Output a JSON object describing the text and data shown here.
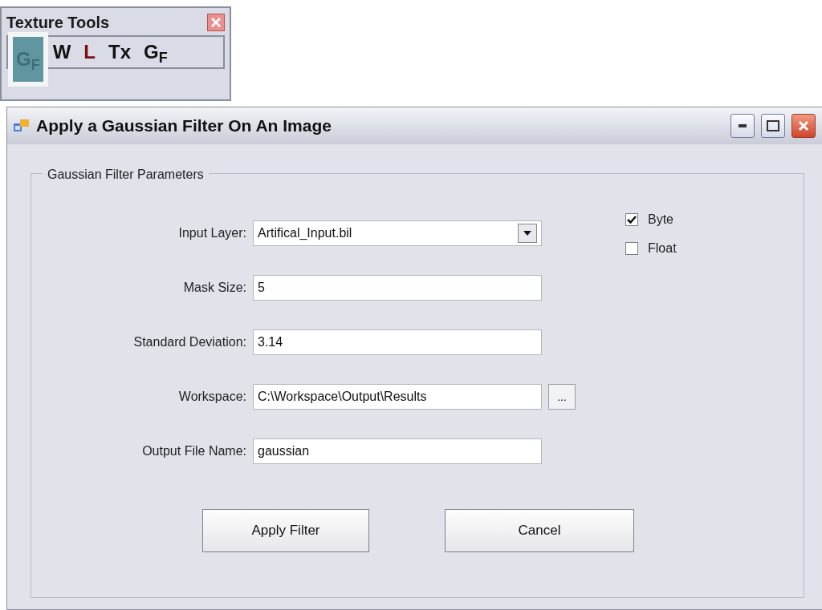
{
  "toolbar": {
    "title": "Texture Tools",
    "tools": [
      {
        "label": "G$_{F}$",
        "selected": true,
        "color": "#3f6e78"
      },
      {
        "label": "W",
        "selected": false,
        "color": "#111111"
      },
      {
        "label": "L",
        "selected": false,
        "color": "#7a0d0d"
      },
      {
        "label": "Tx",
        "selected": false,
        "color": "#111111"
      },
      {
        "label": "G$_{F}$",
        "selected": false,
        "color": "#111111"
      }
    ]
  },
  "dialog": {
    "title": "Apply a Gaussian Filter On An Image",
    "group_title": "Gaussian Filter Parameters",
    "fields": [
      {
        "label": "Input Layer:",
        "value": "Artifical_Input.bil",
        "kind": "dropdown"
      },
      {
        "label": "Mask Size:",
        "value": "5",
        "kind": "text"
      },
      {
        "label": "Standard Deviation:",
        "value": "3.14",
        "kind": "text"
      },
      {
        "label": "Workspace:",
        "value": "C:\\Workspace\\Output\\Results",
        "kind": "browse",
        "browse_label": "..."
      },
      {
        "label": "Output File Name:",
        "value": "gaussian",
        "kind": "text"
      }
    ],
    "options": [
      {
        "label": "Byte",
        "checked": true
      },
      {
        "label": "Float",
        "checked": false
      }
    ],
    "buttons": [
      "Apply Filter",
      "Cancel"
    ]
  }
}
